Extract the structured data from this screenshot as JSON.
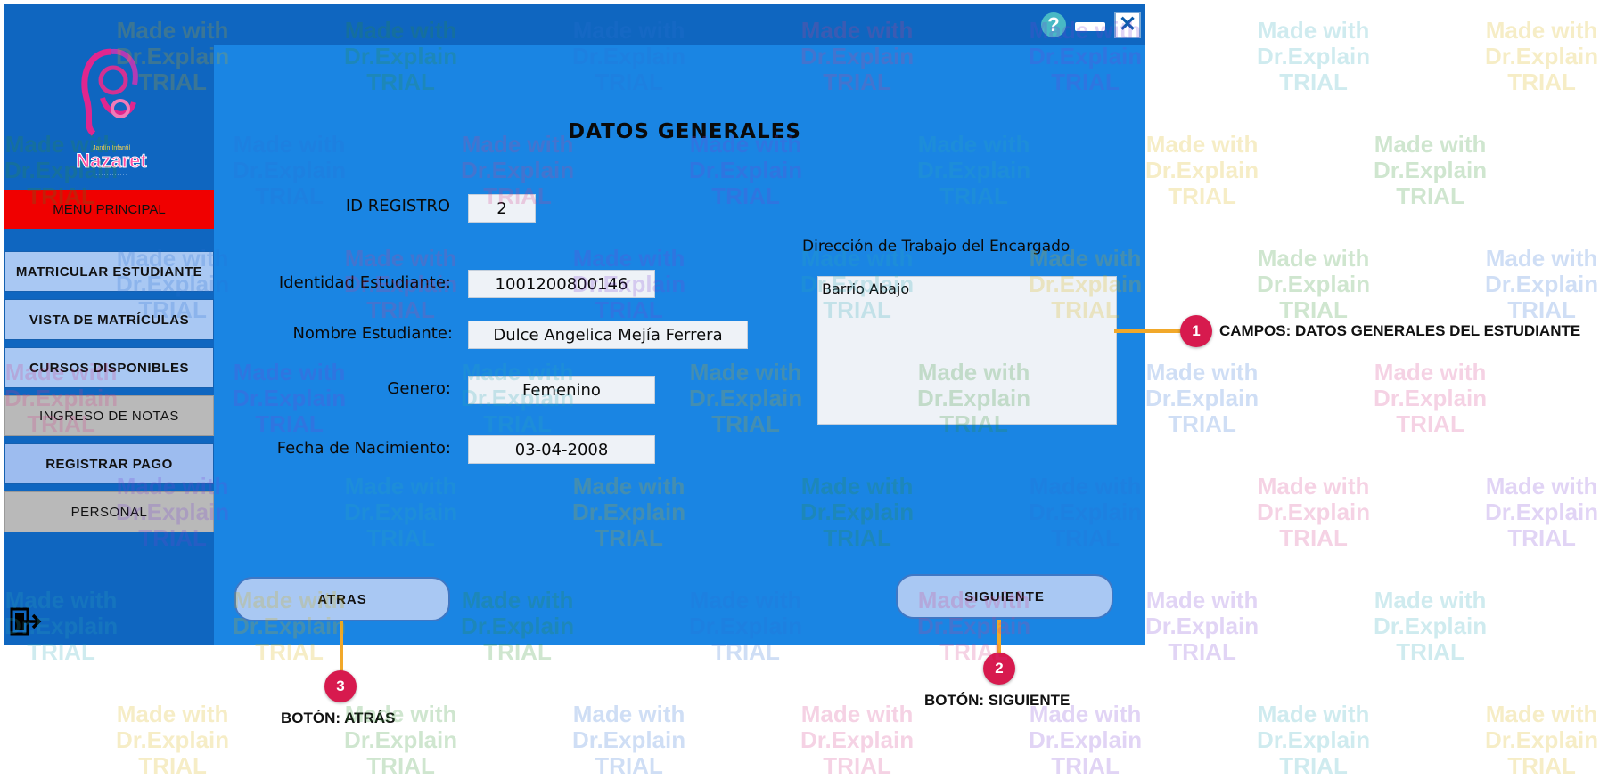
{
  "window": {
    "help_label": "?",
    "close_label": "✕"
  },
  "sidebar": {
    "logo_text": "Nazaret",
    "menu_header": "MENU PRINCIPAL",
    "items": [
      {
        "label": "MATRICULAR ESTUDIANTE"
      },
      {
        "label": "VISTA DE MATRÍCULAS"
      },
      {
        "label": "CURSOS DISPONIBLES"
      },
      {
        "label": "INGRESO DE NOTAS"
      },
      {
        "label": "REGISTRAR PAGO"
      },
      {
        "label": "PERSONAL"
      }
    ]
  },
  "form": {
    "title": "DATOS GENERALES",
    "id_label": "ID REGISTRO",
    "id_value": "2",
    "identity_label": "Identidad Estudiante:",
    "identity_value": "1001200800146",
    "name_label": "Nombre Estudiante:",
    "name_value": "Dulce Angelica Mejía Ferrera",
    "gender_label": "Genero:",
    "gender_value": "Femenino",
    "birth_label": "Fecha de Nacimiento:",
    "birth_value": "03-04-2008",
    "work_address_label": "Dirección de Trabajo del Encargado",
    "work_address_value": "Barrio Abajo",
    "back_button": "ATRAS",
    "next_button": "SIGUIENTE"
  },
  "callouts": [
    {
      "number": "1",
      "text": "CAMPOS: DATOS GENERALES DEL ESTUDIANTE"
    },
    {
      "number": "2",
      "text": "BOTÓN: SIGUIENTE"
    },
    {
      "number": "3",
      "text": "BOTÓN: ATRÁS"
    }
  ],
  "watermark": {
    "line1": "Made with",
    "line2": "Dr.Explain",
    "line3": "TRIAL"
  },
  "colors": {
    "sidebar_bg": "#0f66c0",
    "panel_bg": "#1a85e3",
    "menu_header": "#f00000",
    "callout_badge": "#d71a4e",
    "callout_line": "#f1a82a"
  }
}
